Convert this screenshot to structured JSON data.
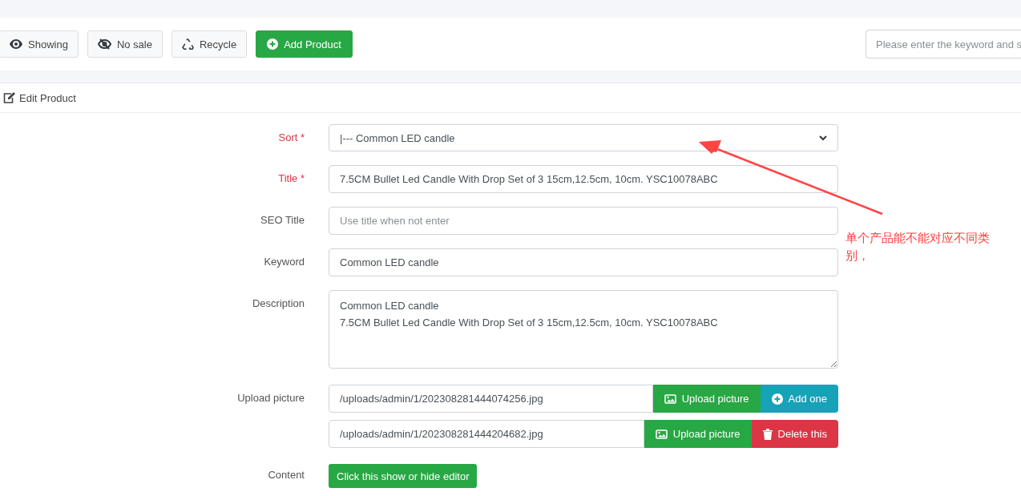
{
  "toolbar": {
    "buttons": [
      {
        "kind": "eye",
        "label": "Showing"
      },
      {
        "kind": "eye-slash",
        "label": "No sale"
      },
      {
        "kind": "recycle",
        "label": "Recycle"
      },
      {
        "kind": "add",
        "label": "Add Product"
      }
    ],
    "search": {
      "placeholder": "Please enter the keyword and s"
    }
  },
  "card": {
    "title": "Edit Product"
  },
  "form": {
    "rows": [
      {
        "kind": "select",
        "label": "Sort *",
        "required": true,
        "value": "|--- Common LED candle"
      },
      {
        "kind": "text",
        "label": "Title *",
        "required": true,
        "value": "7.5CM Bullet Led Candle With Drop Set of 3 15cm,12.5cm, 10cm. YSC10078ABC"
      },
      {
        "kind": "text",
        "label": "SEO Title",
        "required": false,
        "placeholder": "Use title when not enter"
      },
      {
        "kind": "text",
        "label": "Keyword",
        "required": false,
        "value": "Common LED candle"
      },
      {
        "kind": "textarea",
        "label": "Description",
        "required": false,
        "value": "Common LED candle\n7.5CM Bullet Led Candle With Drop Set of 3 15cm,12.5cm, 10cm. YSC10078ABC"
      },
      {
        "kind": "upload",
        "label": "Upload picture",
        "required": false,
        "files": [
          {
            "path": "/uploads/admin/1/202308281444074256.jpg",
            "upload": "Upload picture",
            "action": {
              "kind": "add",
              "label": "Add one"
            }
          },
          {
            "path": "/uploads/admin/1/202308281444204682.jpg",
            "upload": "Upload picture",
            "action": {
              "kind": "delete",
              "label": "Delete this"
            }
          }
        ]
      },
      {
        "kind": "button",
        "label": "Content",
        "required": false,
        "button": "Click this show or hide editor"
      }
    ]
  },
  "annotation": {
    "text": "单个产品能不能对应不同类别，"
  }
}
